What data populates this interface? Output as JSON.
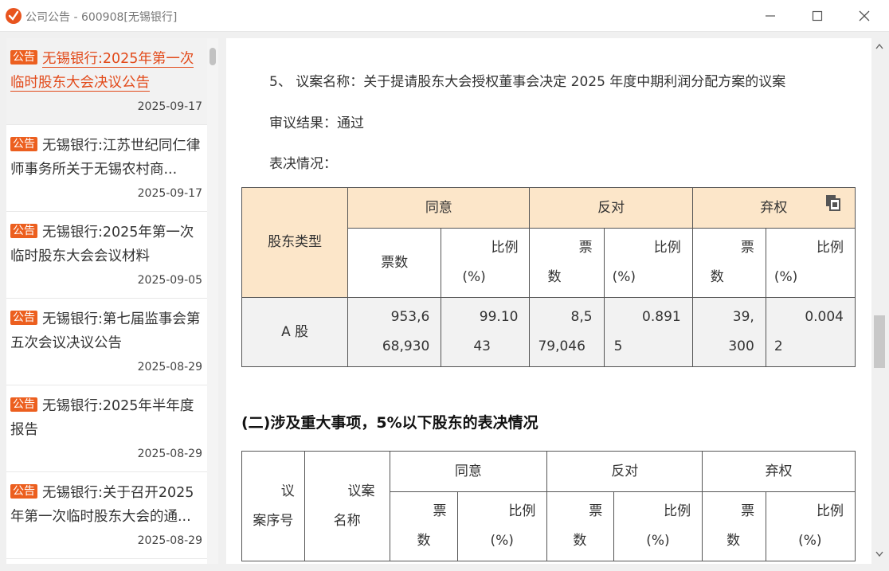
{
  "window": {
    "title": "公司公告 - 600908[无锡银行]"
  },
  "sidebar": {
    "tag_label": "公告",
    "items": [
      {
        "title": "无锡银行:2025年第一次临时股东大会决议公告",
        "date": "2025-09-17",
        "active": true
      },
      {
        "title": "无锡银行:江苏世纪同仁律师事务所关于无锡农村商...",
        "date": "2025-09-17"
      },
      {
        "title": "无锡银行:2025年第一次临时股东大会会议材料",
        "date": "2025-09-05"
      },
      {
        "title": "无锡银行:第七届监事会第五次会议决议公告",
        "date": "2025-08-29"
      },
      {
        "title": "无锡银行:2025年半年度报告",
        "date": "2025-08-29"
      },
      {
        "title": "无锡银行:关于召开2025年第一次临时股东大会的通...",
        "date": "2025-08-29"
      }
    ]
  },
  "content": {
    "proposal_line": "5、 议案名称：关于提请股东大会授权董事会决定 2025 年度中期利润分配方案的议案",
    "result_line": "审议结果：通过",
    "vote_line": "表决情况：",
    "table1": {
      "shareholder_type": "股东类型",
      "agree": "同意",
      "oppose": "反对",
      "abstain": "弃权",
      "votes": "票数",
      "votes_split": [
        "票",
        "数"
      ],
      "ratio": [
        "比例",
        "(%)"
      ],
      "row": {
        "type": "A 股",
        "agree_votes": [
          "953,6",
          "68,930"
        ],
        "agree_ratio": [
          "99.10",
          "43"
        ],
        "oppose_votes": [
          "8,5",
          "79,046"
        ],
        "oppose_ratio": [
          "0.891",
          "5"
        ],
        "abstain_votes": [
          "39,",
          "300"
        ],
        "abstain_ratio": [
          "0.004",
          "2"
        ]
      }
    },
    "section2_title": "(二)涉及重大事项，5%以下股东的表决情况",
    "table2": {
      "seq": [
        "议",
        "案序号"
      ],
      "name": [
        "议案",
        "名称"
      ],
      "agree": "同意",
      "oppose": "反对",
      "abstain": "弃权",
      "votes_split": [
        "票",
        "数"
      ],
      "ratio": [
        "比例",
        "(%)"
      ]
    }
  }
}
